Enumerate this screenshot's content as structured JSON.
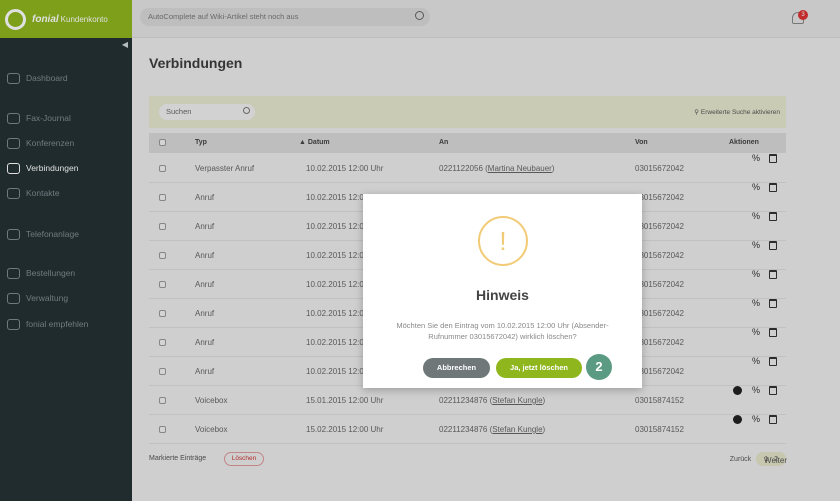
{
  "brand": {
    "name": "fonial",
    "subtitle": "Kundenkonto"
  },
  "topbar": {
    "search_placeholder": "AutoComplete auf Wiki-Artikel steht noch aus",
    "notification_count": "3"
  },
  "sidebar": {
    "collapse_glyph": "◀",
    "items": [
      {
        "label": "Dashboard"
      },
      {
        "label": "Fax-Journal"
      },
      {
        "label": "Konferenzen"
      },
      {
        "label": "Verbindungen"
      },
      {
        "label": "Kontakte"
      },
      {
        "label": "Telefonanlage"
      },
      {
        "label": "Bestellungen"
      },
      {
        "label": "Verwaltung"
      },
      {
        "label": "fonial empfehlen"
      }
    ]
  },
  "page": {
    "title": "Verbindungen"
  },
  "filter": {
    "search_placeholder": "Suchen",
    "advanced_label": "Erweiterte Suche aktivieren"
  },
  "table": {
    "headers": {
      "typ": "Typ",
      "datum": "Datum",
      "an": "An",
      "von": "Von",
      "aktionen": "Aktionen"
    },
    "rows": [
      {
        "typ": "Verpasster Anruf",
        "datum": "10.02.2015 12:00 Uhr",
        "an_number": "0221122056",
        "an_name": "Martina Neubauer",
        "von": "03015672042"
      },
      {
        "typ": "Anruf",
        "datum": "10.02.2015 12:00 Uhr",
        "von": "03015672042"
      },
      {
        "typ": "Anruf",
        "datum": "10.02.2015 12:00 Uhr",
        "von": "03015672042"
      },
      {
        "typ": "Anruf",
        "datum": "10.02.2015 12:00 Uhr",
        "von": "03015672042"
      },
      {
        "typ": "Anruf",
        "datum": "10.02.2015 12:00 Uhr",
        "von": "03015672042"
      },
      {
        "typ": "Anruf",
        "datum": "10.02.2015 12:00 Uhr",
        "von": "03015672042"
      },
      {
        "typ": "Anruf",
        "datum": "10.02.2015 12:00 Uhr",
        "von": "03015672042"
      },
      {
        "typ": "Anruf",
        "datum": "10.02.2015 12:00 Uhr",
        "von": "03015672042"
      },
      {
        "typ": "Voicebox",
        "datum": "15.01.2015 12:00 Uhr",
        "an_number": "02211234876",
        "an_name": "Stefan Kungle",
        "von": "03015874152"
      },
      {
        "typ": "Voicebox",
        "datum": "15.02.2015 12:00 Uhr",
        "an_number": "02211234876",
        "an_name": "Stefan Kungle",
        "von": "03015874152"
      }
    ]
  },
  "footer": {
    "marked_label": "Markierte Einträge",
    "delete_label": "Löschen",
    "prev_label": "Zurück",
    "pages": [
      "1",
      "2"
    ],
    "next_label": "Weiter"
  },
  "modal": {
    "title": "Hinweis",
    "message": "Möchten Sie den Eintrag vom 10.02.2015 12:00 Uhr (Absender-Rufnummer 03015672042) wirklich löschen?",
    "cancel_label": "Abbrechen",
    "confirm_label": "Ja, jetzt löschen",
    "step_number": "2",
    "icon_glyph": "!"
  },
  "colors": {
    "accent": "#8fb61d",
    "sidebar": "#253235",
    "warning": "#f2cb76",
    "step": "#5b9b83"
  }
}
